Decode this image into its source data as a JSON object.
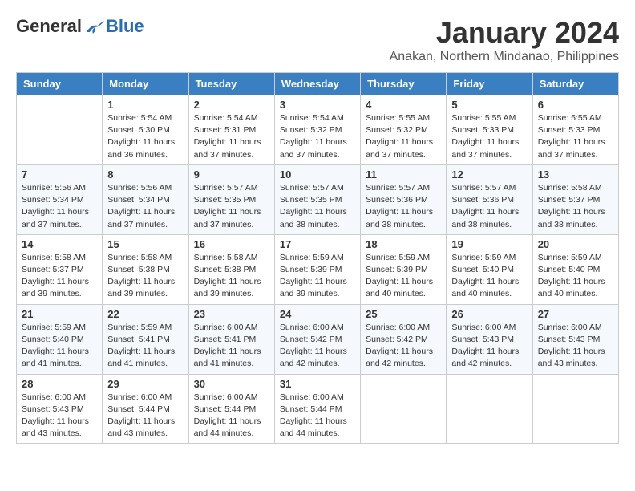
{
  "header": {
    "logo_general": "General",
    "logo_blue": "Blue",
    "month_title": "January 2024",
    "location": "Anakan, Northern Mindanao, Philippines"
  },
  "days_of_week": [
    "Sunday",
    "Monday",
    "Tuesday",
    "Wednesday",
    "Thursday",
    "Friday",
    "Saturday"
  ],
  "weeks": [
    [
      {
        "day": "",
        "info": ""
      },
      {
        "day": "1",
        "info": "Sunrise: 5:54 AM\nSunset: 5:30 PM\nDaylight: 11 hours\nand 36 minutes."
      },
      {
        "day": "2",
        "info": "Sunrise: 5:54 AM\nSunset: 5:31 PM\nDaylight: 11 hours\nand 37 minutes."
      },
      {
        "day": "3",
        "info": "Sunrise: 5:54 AM\nSunset: 5:32 PM\nDaylight: 11 hours\nand 37 minutes."
      },
      {
        "day": "4",
        "info": "Sunrise: 5:55 AM\nSunset: 5:32 PM\nDaylight: 11 hours\nand 37 minutes."
      },
      {
        "day": "5",
        "info": "Sunrise: 5:55 AM\nSunset: 5:33 PM\nDaylight: 11 hours\nand 37 minutes."
      },
      {
        "day": "6",
        "info": "Sunrise: 5:55 AM\nSunset: 5:33 PM\nDaylight: 11 hours\nand 37 minutes."
      }
    ],
    [
      {
        "day": "7",
        "info": "Sunrise: 5:56 AM\nSunset: 5:34 PM\nDaylight: 11 hours\nand 37 minutes."
      },
      {
        "day": "8",
        "info": "Sunrise: 5:56 AM\nSunset: 5:34 PM\nDaylight: 11 hours\nand 37 minutes."
      },
      {
        "day": "9",
        "info": "Sunrise: 5:57 AM\nSunset: 5:35 PM\nDaylight: 11 hours\nand 37 minutes."
      },
      {
        "day": "10",
        "info": "Sunrise: 5:57 AM\nSunset: 5:35 PM\nDaylight: 11 hours\nand 38 minutes."
      },
      {
        "day": "11",
        "info": "Sunrise: 5:57 AM\nSunset: 5:36 PM\nDaylight: 11 hours\nand 38 minutes."
      },
      {
        "day": "12",
        "info": "Sunrise: 5:57 AM\nSunset: 5:36 PM\nDaylight: 11 hours\nand 38 minutes."
      },
      {
        "day": "13",
        "info": "Sunrise: 5:58 AM\nSunset: 5:37 PM\nDaylight: 11 hours\nand 38 minutes."
      }
    ],
    [
      {
        "day": "14",
        "info": "Sunrise: 5:58 AM\nSunset: 5:37 PM\nDaylight: 11 hours\nand 39 minutes."
      },
      {
        "day": "15",
        "info": "Sunrise: 5:58 AM\nSunset: 5:38 PM\nDaylight: 11 hours\nand 39 minutes."
      },
      {
        "day": "16",
        "info": "Sunrise: 5:58 AM\nSunset: 5:38 PM\nDaylight: 11 hours\nand 39 minutes."
      },
      {
        "day": "17",
        "info": "Sunrise: 5:59 AM\nSunset: 5:39 PM\nDaylight: 11 hours\nand 39 minutes."
      },
      {
        "day": "18",
        "info": "Sunrise: 5:59 AM\nSunset: 5:39 PM\nDaylight: 11 hours\nand 40 minutes."
      },
      {
        "day": "19",
        "info": "Sunrise: 5:59 AM\nSunset: 5:40 PM\nDaylight: 11 hours\nand 40 minutes."
      },
      {
        "day": "20",
        "info": "Sunrise: 5:59 AM\nSunset: 5:40 PM\nDaylight: 11 hours\nand 40 minutes."
      }
    ],
    [
      {
        "day": "21",
        "info": "Sunrise: 5:59 AM\nSunset: 5:40 PM\nDaylight: 11 hours\nand 41 minutes."
      },
      {
        "day": "22",
        "info": "Sunrise: 5:59 AM\nSunset: 5:41 PM\nDaylight: 11 hours\nand 41 minutes."
      },
      {
        "day": "23",
        "info": "Sunrise: 6:00 AM\nSunset: 5:41 PM\nDaylight: 11 hours\nand 41 minutes."
      },
      {
        "day": "24",
        "info": "Sunrise: 6:00 AM\nSunset: 5:42 PM\nDaylight: 11 hours\nand 42 minutes."
      },
      {
        "day": "25",
        "info": "Sunrise: 6:00 AM\nSunset: 5:42 PM\nDaylight: 11 hours\nand 42 minutes."
      },
      {
        "day": "26",
        "info": "Sunrise: 6:00 AM\nSunset: 5:43 PM\nDaylight: 11 hours\nand 42 minutes."
      },
      {
        "day": "27",
        "info": "Sunrise: 6:00 AM\nSunset: 5:43 PM\nDaylight: 11 hours\nand 43 minutes."
      }
    ],
    [
      {
        "day": "28",
        "info": "Sunrise: 6:00 AM\nSunset: 5:43 PM\nDaylight: 11 hours\nand 43 minutes."
      },
      {
        "day": "29",
        "info": "Sunrise: 6:00 AM\nSunset: 5:44 PM\nDaylight: 11 hours\nand 43 minutes."
      },
      {
        "day": "30",
        "info": "Sunrise: 6:00 AM\nSunset: 5:44 PM\nDaylight: 11 hours\nand 44 minutes."
      },
      {
        "day": "31",
        "info": "Sunrise: 6:00 AM\nSunset: 5:44 PM\nDaylight: 11 hours\nand 44 minutes."
      },
      {
        "day": "",
        "info": ""
      },
      {
        "day": "",
        "info": ""
      },
      {
        "day": "",
        "info": ""
      }
    ]
  ]
}
